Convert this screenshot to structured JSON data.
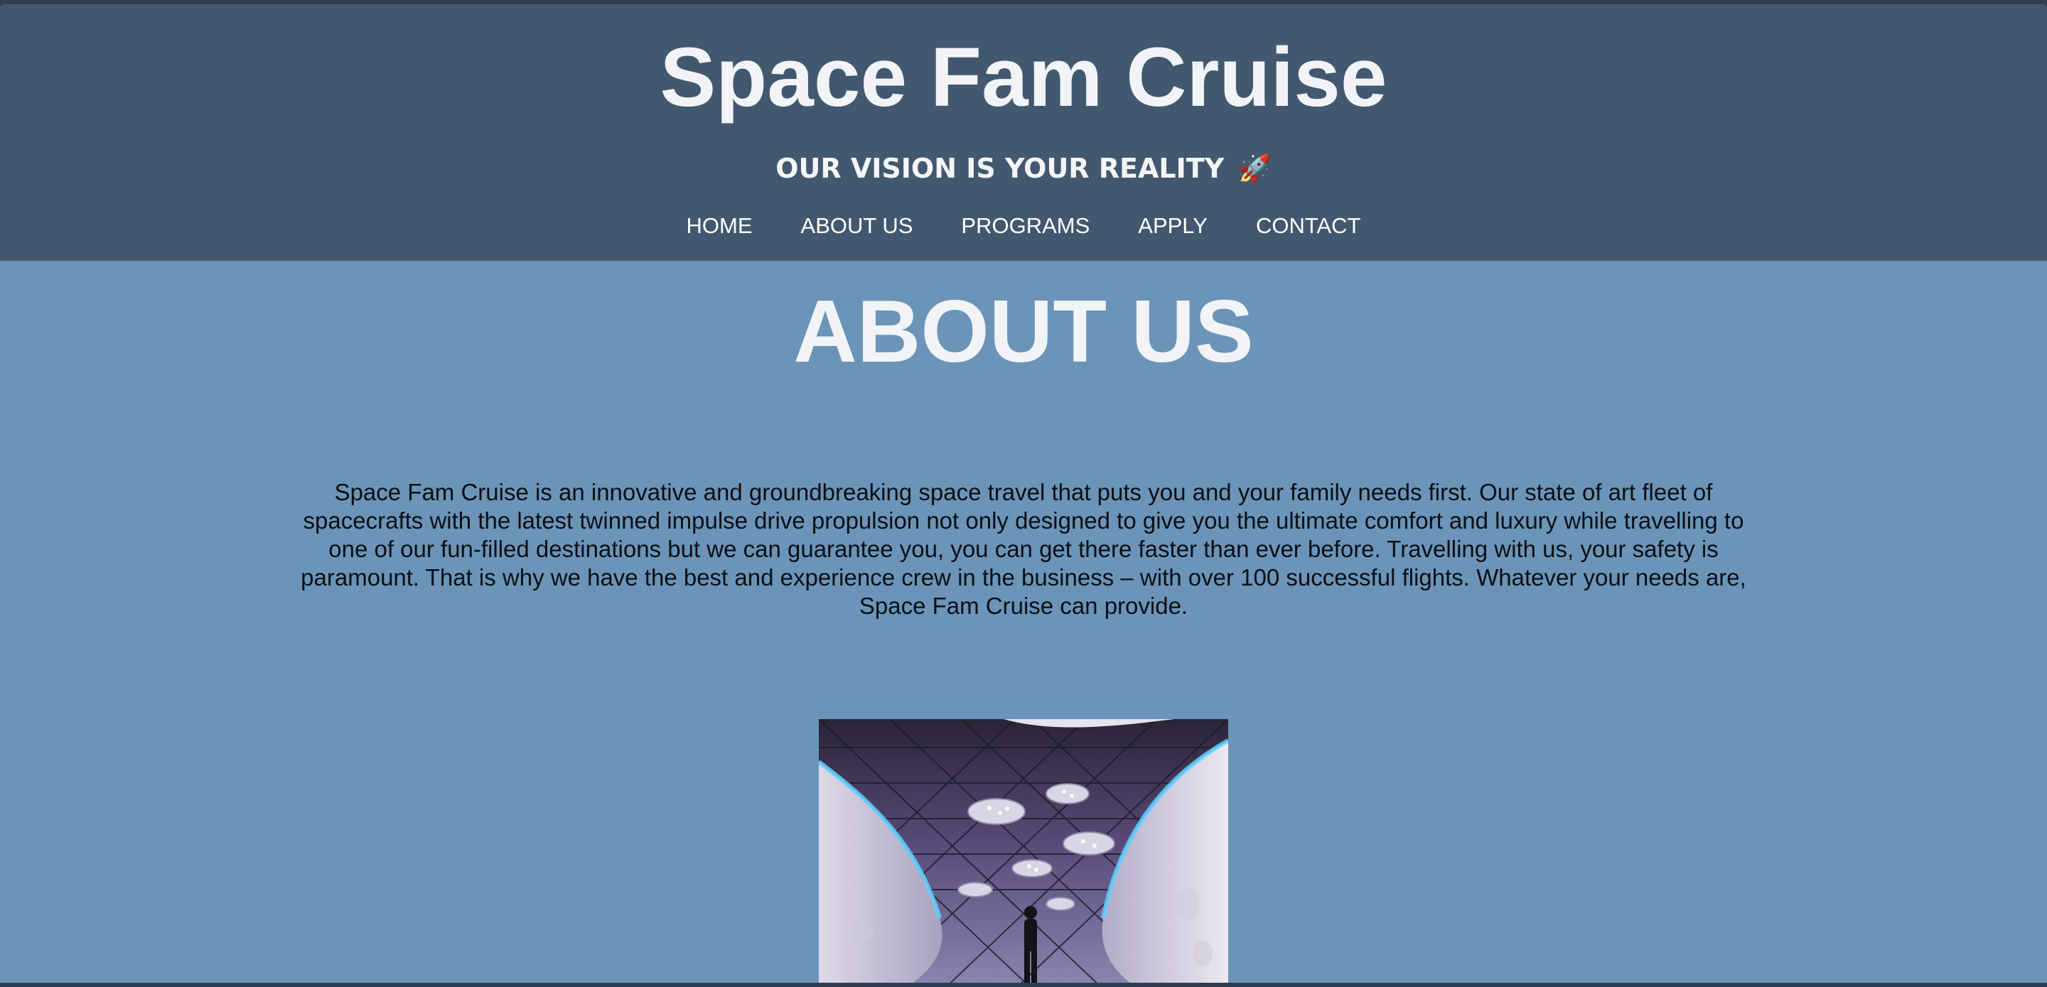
{
  "header": {
    "title": "Space Fam Cruise",
    "tagline": "OUR VISION IS YOUR REALITY",
    "tagline_icon": "🚀"
  },
  "nav": {
    "items": [
      {
        "label": "HOME"
      },
      {
        "label": "ABOUT US"
      },
      {
        "label": "PROGRAMS"
      },
      {
        "label": "APPLY"
      },
      {
        "label": "CONTACT"
      }
    ]
  },
  "about": {
    "heading": "ABOUT US",
    "body": "Space Fam Cruise is an innovative and groundbreaking space travel that puts you and your family needs first. Our state of art fleet of spacecrafts with the latest twinned impulse drive propulsion not only designed to give you the ultimate comfort and luxury while travelling to one of our fun-filled destinations but we can guarantee you, you can get there faster than ever before. Travelling with us, your safety is paramount. That is why we have the best and experience crew in the business – with over 100 successful flights. Whatever your needs are, Space Fam Cruise can provide."
  },
  "colors": {
    "header_bg": "#42586f",
    "page_bg": "#6b94b8",
    "title_text": "#f1f3f6",
    "body_text": "#0b0f14",
    "accent_glow": "#5fd0ff"
  }
}
